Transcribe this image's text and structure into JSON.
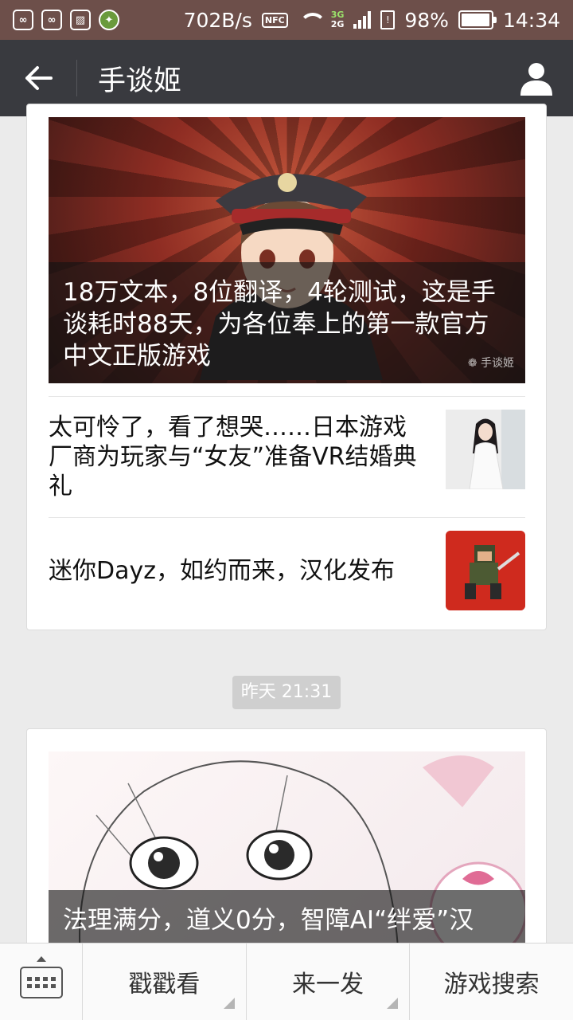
{
  "status_bar": {
    "speed": "702B/s",
    "nfc": "NFC",
    "net_3g": "3G",
    "net_2g": "2G",
    "battery": "98%",
    "battery_level": 0.98,
    "time": "14:34"
  },
  "header": {
    "title": "手谈姬"
  },
  "feed": {
    "card1": {
      "hero_title": "18万文本，8位翻译，4轮测试，这是手谈耗时88天，为各位奉上的第一款官方中文正版游戏",
      "watermark": "手谈姬",
      "items": [
        {
          "title": "太可怜了，看了想哭……日本游戏厂商为玩家与“女友”准备VR结婚典礼"
        },
        {
          "title": "迷你Dayz，如约而来，汉化发布"
        }
      ]
    },
    "time_badge": "昨天 21:31",
    "card2": {
      "hero_title": "法理满分，道义0分，智障AI“绊爱”汉"
    }
  },
  "bottom_menu": {
    "items": [
      "戳戳看",
      "来一发",
      "游戏搜索"
    ]
  }
}
